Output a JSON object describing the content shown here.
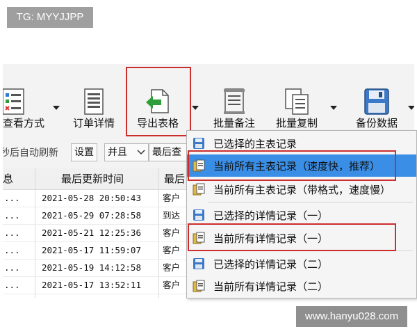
{
  "tag": "TG: MYYJJPP",
  "watermark": "www.hanyu028.com",
  "toolbar": {
    "view_mode": "查看方式",
    "order_details": "订单详情",
    "export_table": "导出表格",
    "batch_remark": "批量备注",
    "batch_copy": "批量复制",
    "backup_data": "备份数据"
  },
  "row2": {
    "auto_refresh": "秒后自动刷新",
    "settings": "设置",
    "combine": "并且",
    "last_query": "最后查"
  },
  "table": {
    "headers": [
      "息",
      "最后更新时间",
      "最后"
    ],
    "rows": [
      {
        "c1": "...",
        "time": "2021-05-28 20:50:43",
        "c3": "客户"
      },
      {
        "c1": "...",
        "time": "2021-05-29 07:28:58",
        "c3": "到达"
      },
      {
        "c1": "...",
        "time": "2021-05-21 12:25:36",
        "c3": "客户"
      },
      {
        "c1": "...",
        "time": "2021-05-17 11:59:07",
        "c3": "客户"
      },
      {
        "c1": "...",
        "time": "2021-05-19 14:12:58",
        "c3": "客户"
      },
      {
        "c1": "...",
        "time": "2021-05-17 13:52:11",
        "c3": "客户"
      }
    ]
  },
  "menu": {
    "items": [
      "已选择的主表记录",
      "当前所有主表记录（速度快，推荐）",
      "当前所有主表记录（带格式，速度慢）",
      "已选择的详情记录（一）",
      "当前所有详情记录（一）",
      "已选择的详情记录（二）",
      "当前所有详情记录（二）"
    ],
    "selected_index": 1
  },
  "colors": {
    "highlight_blue": "#3a8ee6",
    "annotation_red": "#cc2d2d",
    "export_arrow_green": "#2e9e3a"
  }
}
